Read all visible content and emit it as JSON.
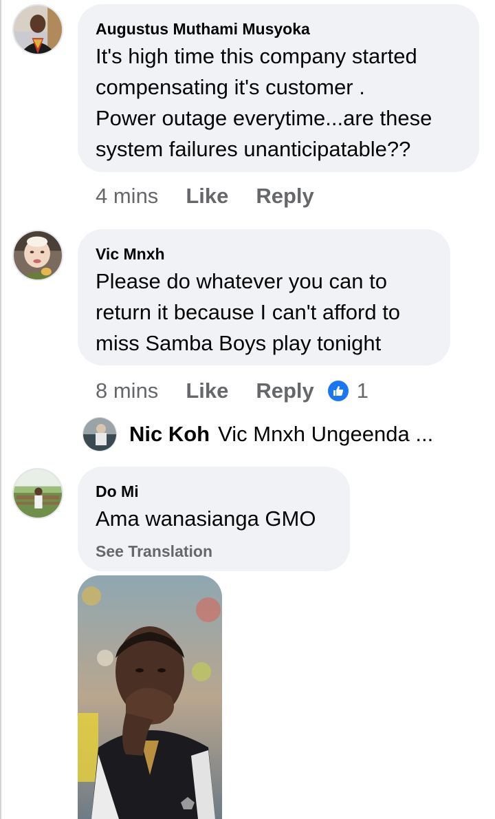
{
  "comments": [
    {
      "author": "Augustus Muthami Musyoka",
      "text_lines": [
        "It's high time this company started",
        "compensating it's customer .",
        "Power outage everytime...are these",
        "system failures unanticipatable??"
      ],
      "time": "4 mins",
      "like_label": "Like",
      "reply_label": "Reply"
    },
    {
      "author": "Vic Mnxh",
      "text_lines": [
        "Please do whatever you can to",
        "return it because I can't afford to",
        "miss Samba Boys play tonight"
      ],
      "time": "8 mins",
      "like_label": "Like",
      "reply_label": "Reply",
      "reaction_count": "1",
      "reply_preview": {
        "author": "Nic Koh",
        "text": "Vic Mnxh Ungeenda ..."
      }
    },
    {
      "author": "Do Mi",
      "text_lines": [
        "Ama wanasianga GMO"
      ],
      "see_translation": "See Translation"
    }
  ],
  "icons": {
    "reaction": "thumbs-up-icon",
    "reaction_color": "#1877f2"
  }
}
